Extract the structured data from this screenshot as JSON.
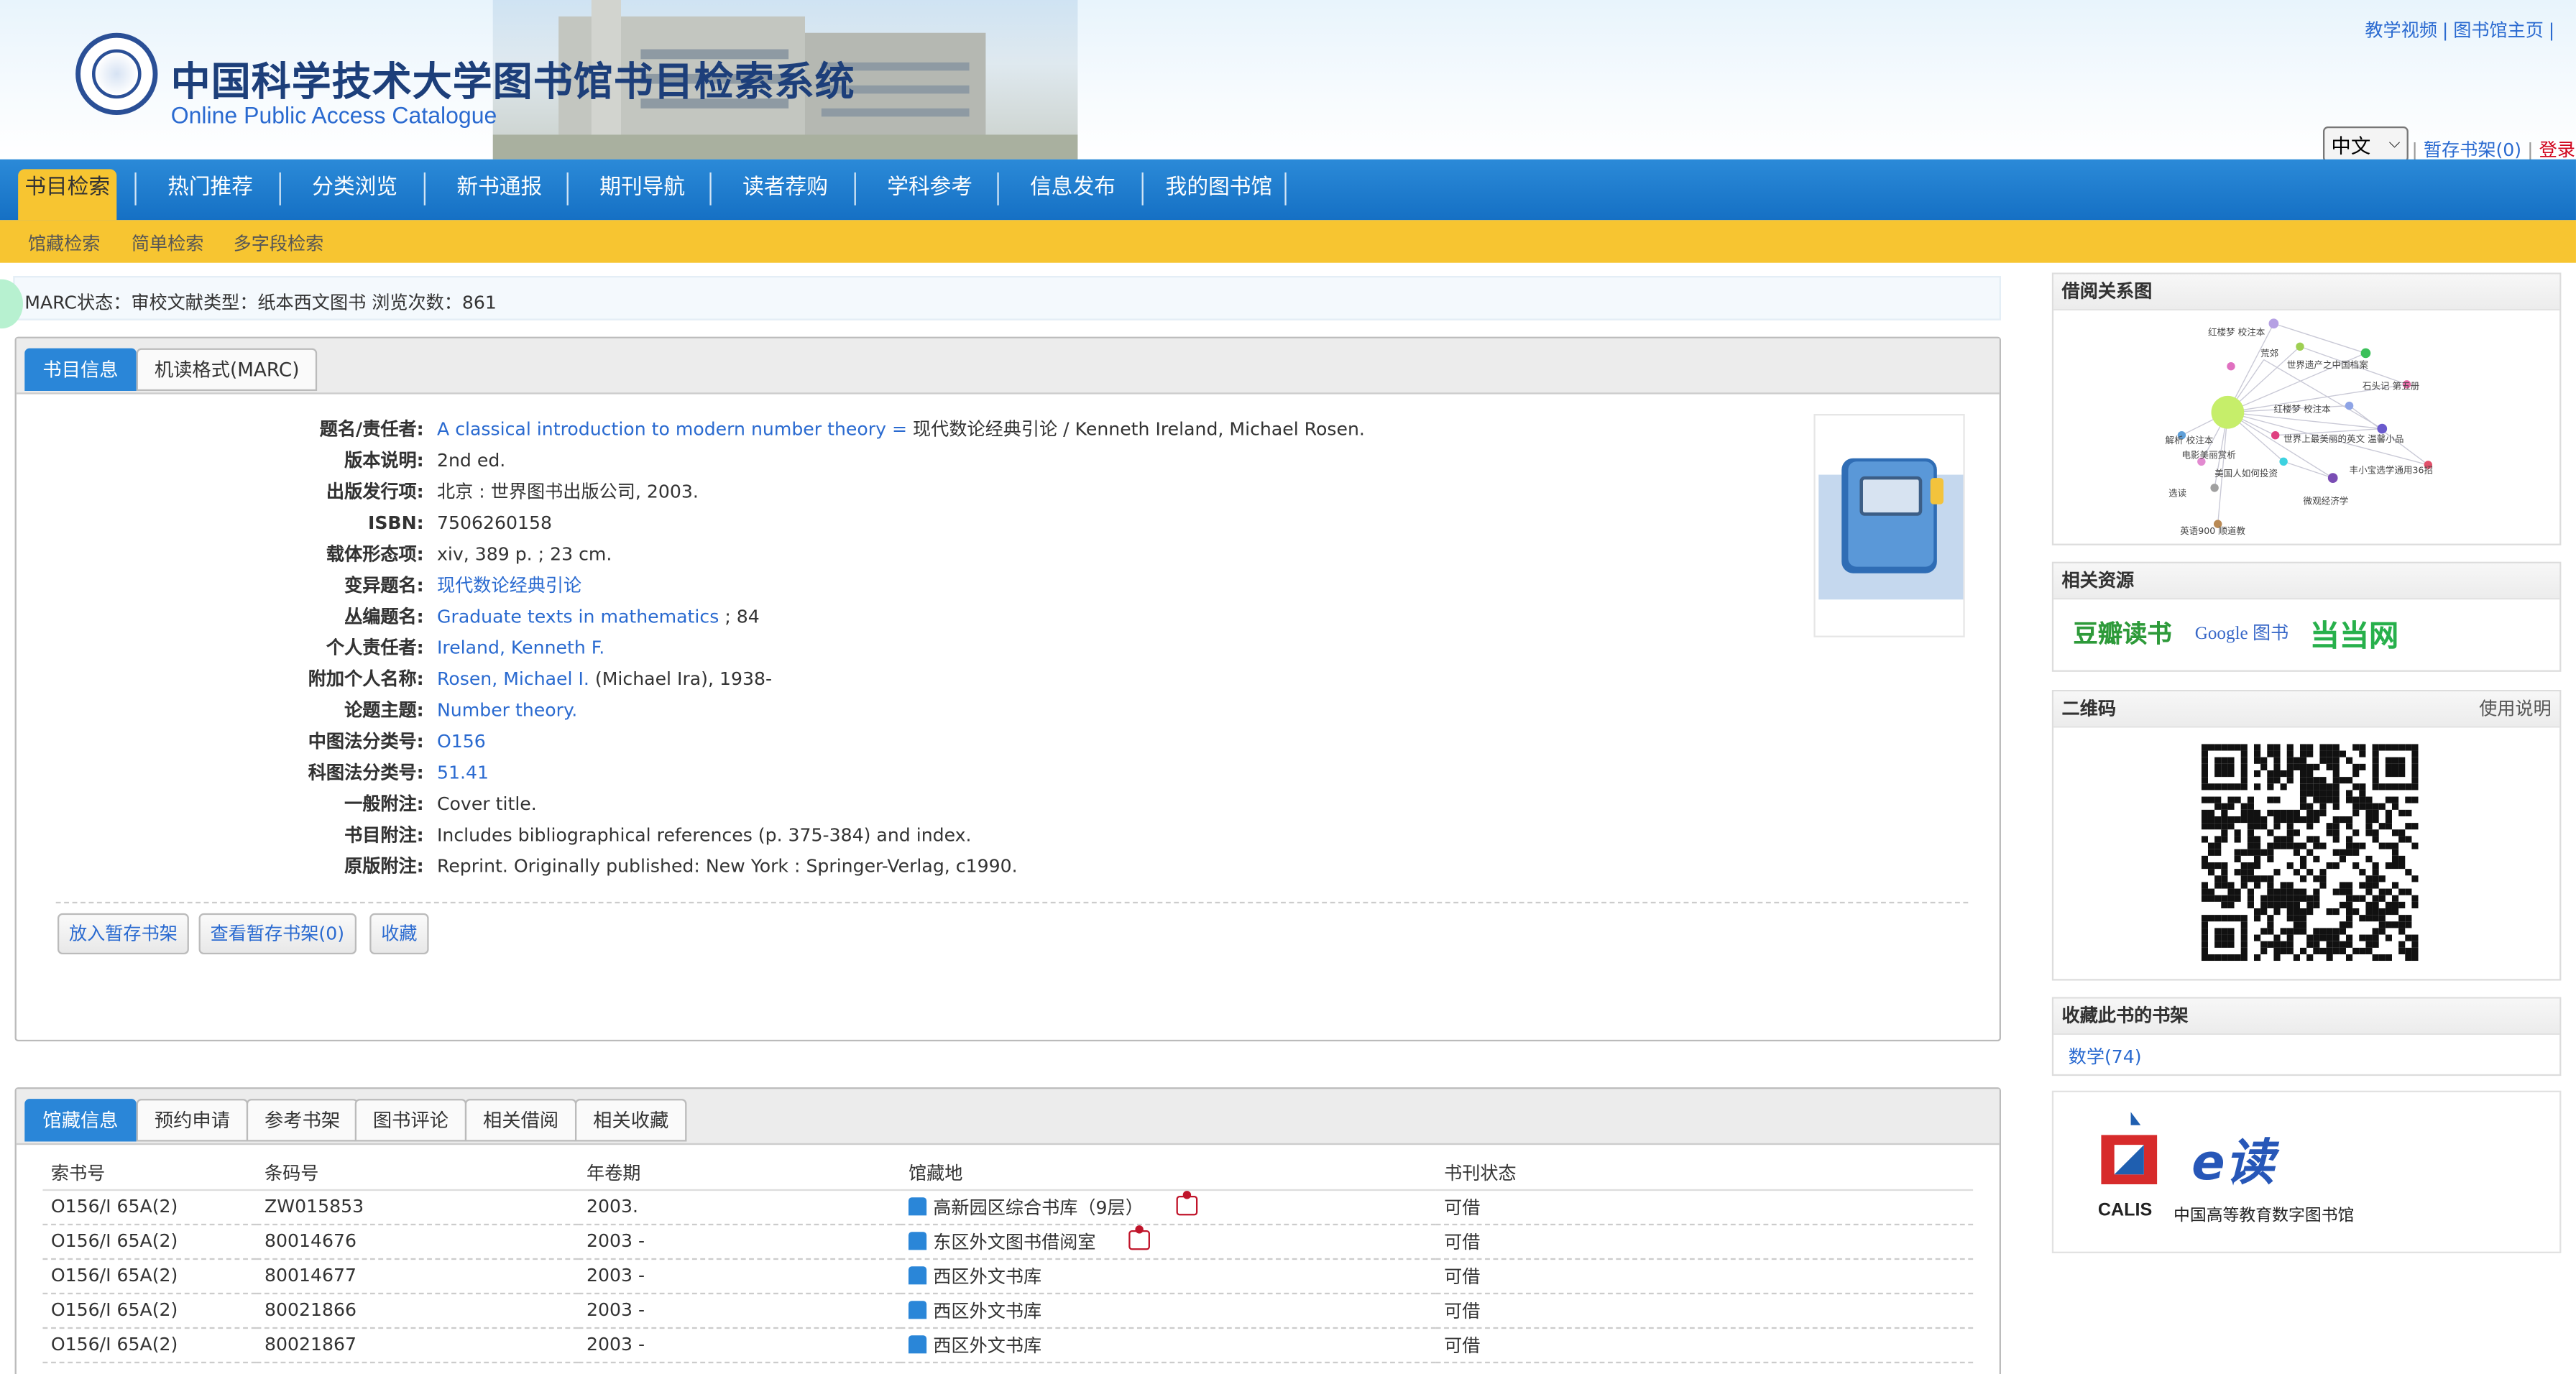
{
  "header": {
    "title": "中国科学技术大学图书馆书目检索系统",
    "subtitle": "Online Public Access Catalogue",
    "top_links": [
      "教学视频",
      "图书馆主页"
    ],
    "language": "中文",
    "shelf_link": "暂存书架(0)",
    "login": "登录"
  },
  "nav": {
    "items": [
      "书目检索",
      "热门推荐",
      "分类浏览",
      "新书通报",
      "期刊导航",
      "读者荐购",
      "学科参考",
      "信息发布",
      "我的图书馆"
    ],
    "sub_items": [
      "馆藏检索",
      "简单检索",
      "多字段检索"
    ]
  },
  "status_line": "MARC状态：审校文献类型：纸本西文图书 浏览次数：861",
  "book_tabs": [
    "书目信息",
    "机读格式(MARC)"
  ],
  "record": {
    "fields": [
      {
        "label": "题名/责任者:",
        "link": "A classical introduction to modern number theory =",
        "text": "现代数论经典引论 / Kenneth Ireland, Michael Rosen."
      },
      {
        "label": "版本说明:",
        "link": "",
        "text": "2nd ed."
      },
      {
        "label": "出版发行项:",
        "link": "",
        "text": "北京 : 世界图书出版公司, 2003."
      },
      {
        "label": "ISBN:",
        "link": "",
        "text": "7506260158"
      },
      {
        "label": "载体形态项:",
        "link": "",
        "text": "xiv, 389 p. ; 23 cm."
      },
      {
        "label": "变异题名:",
        "link": "现代数论经典引论",
        "text": ""
      },
      {
        "label": "丛编题名:",
        "link": "Graduate texts in mathematics",
        "text": "; 84"
      },
      {
        "label": "个人责任者:",
        "link": "Ireland, Kenneth F.",
        "text": ""
      },
      {
        "label": "附加个人名称:",
        "link": "Rosen, Michael I.",
        "text": "(Michael Ira), 1938-"
      },
      {
        "label": "论题主题:",
        "link": "Number theory.",
        "text": ""
      },
      {
        "label": "中图法分类号:",
        "link": "O156",
        "text": ""
      },
      {
        "label": "科图法分类号:",
        "link": "51.41",
        "text": ""
      },
      {
        "label": "一般附注:",
        "link": "",
        "text": "Cover title."
      },
      {
        "label": "书目附注:",
        "link": "",
        "text": "Includes bibliographical references (p. 375-384) and index."
      },
      {
        "label": "原版附注:",
        "link": "",
        "text": "Reprint. Originally published: New York : Springer-Verlag, c1990."
      }
    ],
    "buttons": [
      "放入暂存书架",
      "查看暂存书架(0)",
      "收藏"
    ]
  },
  "holdings_tabs": [
    "馆藏信息",
    "预约申请",
    "参考书架",
    "图书评论",
    "相关借阅",
    "相关收藏"
  ],
  "holdings": {
    "columns": [
      "索书号",
      "条码号",
      "年卷期",
      "馆藏地",
      "书刊状态"
    ],
    "rows": [
      {
        "call": "O156/I 65A(2)",
        "barcode": "ZW015853",
        "volume": "2003.",
        "location": "高新园区综合书库（9层）",
        "map": true,
        "status": "可借"
      },
      {
        "call": "O156/I 65A(2)",
        "barcode": "80014676",
        "volume": "2003 -",
        "location": "东区外文图书借阅室",
        "map": true,
        "status": "可借"
      },
      {
        "call": "O156/I 65A(2)",
        "barcode": "80014677",
        "volume": "2003 -",
        "location": "西区外文书库",
        "map": false,
        "status": "可借"
      },
      {
        "call": "O156/I 65A(2)",
        "barcode": "80021866",
        "volume": "2003 -",
        "location": "西区外文书库",
        "map": false,
        "status": "可借"
      },
      {
        "call": "O156/I 65A(2)",
        "barcode": "80021867",
        "volume": "2003 -",
        "location": "西区外文书库",
        "map": false,
        "status": "可借"
      }
    ]
  },
  "sidebar": {
    "graph_title": "借阅关系图",
    "graph_labels": [
      "红楼梦 校注本",
      "荒郊",
      "世界遗产之中国档案",
      "石头记 第五册",
      "红楼梦 校注本",
      "解析 校注本",
      "电影美丽赏析",
      "世界上最美丽的英文 温馨小品",
      "美国人如何投资",
      "丰小宝选学通用36招",
      "选读",
      "微观经济学",
      "英语900 顺道教"
    ],
    "resources_title": "相关资源",
    "resources": [
      "豆瓣读书",
      "Google 图书",
      "当当网"
    ],
    "qr_title": "二维码",
    "qr_help": "使用说明",
    "fav_title": "收藏此书的书架",
    "fav_item": "数学(74)",
    "calis_logo": "CALIS",
    "calis_text": "中国高等教育数字图书馆",
    "eread": "e读"
  },
  "colors": {
    "nav_blue": "#1a78cc",
    "nav_yellow": "#f7c531",
    "link_blue": "#2a6ad0",
    "available_green": "#1b8f2d"
  }
}
